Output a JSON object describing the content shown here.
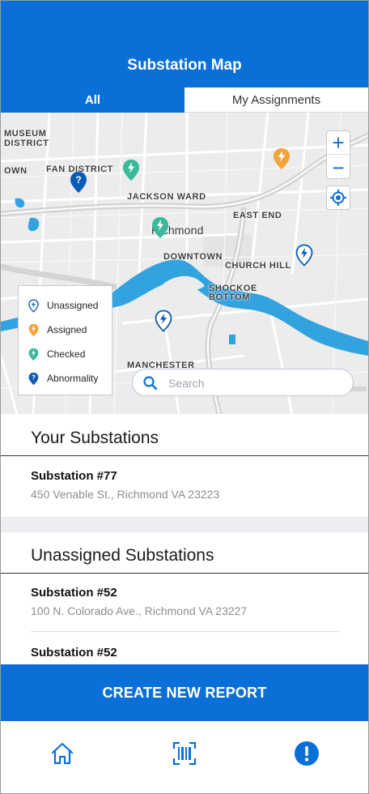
{
  "header": {
    "title": "Substation Map"
  },
  "tabs": [
    {
      "label": "All",
      "active": true
    },
    {
      "label": "My Assignments",
      "active": false
    }
  ],
  "map": {
    "labels": {
      "museum_district": "MUSEUM",
      "museum_district_2": "DISTRICT",
      "fan_district": "FAN DISTRICT",
      "own": "OWN",
      "jackson_ward": "JACKSON WARD",
      "richmond": "Richmond",
      "east_end": "EAST END",
      "downtown": "DOWNTOWN",
      "church_hill": "CHURCH HILL",
      "shockoe": "SHOCKOE",
      "bottom": "BOTTOM",
      "manchester": "MANCHESTER"
    },
    "zoom_in_label": "+",
    "zoom_out_label": "−"
  },
  "legend": [
    {
      "label": "Unassigned",
      "color": "#0a5bb5",
      "icon": "lightning-pin-outline-icon"
    },
    {
      "label": "Assigned",
      "color": "#f2a43a",
      "icon": "lightning-pin-icon"
    },
    {
      "label": "Checked",
      "color": "#3cb89a",
      "icon": "lightning-pin-icon"
    },
    {
      "label": "Abnormality",
      "color": "#0a5bb5",
      "icon": "question-pin-icon"
    }
  ],
  "search": {
    "placeholder": "Search"
  },
  "your_substations": {
    "title": "Your Substations",
    "items": [
      {
        "name": "Substation #77",
        "address": "450 Venable St., Richmond VA 23223"
      }
    ]
  },
  "unassigned_substations": {
    "title": "Unassigned Substations",
    "items": [
      {
        "name": "Substation #52",
        "address": "100 N. Colorado Ave., Richmond VA 23227"
      },
      {
        "name": "Substation #52",
        "address": ""
      }
    ]
  },
  "cta": {
    "label": "CREATE NEW REPORT"
  },
  "nav": [
    {
      "icon": "home-icon"
    },
    {
      "icon": "barcode-scan-icon"
    },
    {
      "icon": "alert-icon"
    }
  ],
  "colors": {
    "brand": "#0a6fd6",
    "unassigned": "#0a5bb5",
    "assigned": "#f2a43a",
    "checked": "#3cb89a"
  }
}
